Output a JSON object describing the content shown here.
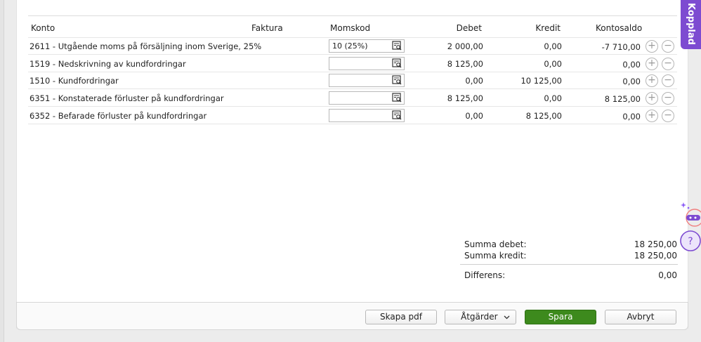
{
  "columns": {
    "konto": "Konto",
    "faktura": "Faktura",
    "momskod": "Momskod",
    "debet": "Debet",
    "kredit": "Kredit",
    "kontosaldo": "Kontosaldo"
  },
  "rows": [
    {
      "konto": "2611 - Utgående moms på försäljning inom Sverige, 25%",
      "momskod": "10 (25%)",
      "debet": "2 000,00",
      "kredit": "0,00",
      "saldo": "-7 710,00"
    },
    {
      "konto": "1519 - Nedskrivning av kundfordringar",
      "momskod": "",
      "debet": "8 125,00",
      "kredit": "0,00",
      "saldo": "0,00"
    },
    {
      "konto": "1510 - Kundfordringar",
      "momskod": "",
      "debet": "0,00",
      "kredit": "10 125,00",
      "saldo": "0,00"
    },
    {
      "konto": "6351 - Konstaterade förluster på kundfordringar",
      "momskod": "",
      "debet": "8 125,00",
      "kredit": "0,00",
      "saldo": "8 125,00"
    },
    {
      "konto": "6352 - Befarade förluster på kundfordringar",
      "momskod": "",
      "debet": "0,00",
      "kredit": "8 125,00",
      "saldo": "0,00"
    }
  ],
  "summary": {
    "sum_debet_label": "Summa debet:",
    "sum_debet_value": "18 250,00",
    "sum_kredit_label": "Summa kredit:",
    "sum_kredit_value": "18 250,00",
    "diff_label": "Differens:",
    "diff_value": "0,00"
  },
  "buttons": {
    "pdf": "Skapa pdf",
    "actions": "Åtgärder",
    "save": "Spara",
    "cancel": "Avbryt"
  },
  "side_tab": "Kopplad",
  "colors": {
    "accent_purple": "#7d4bd1",
    "save_green": "#3d8a1d"
  }
}
